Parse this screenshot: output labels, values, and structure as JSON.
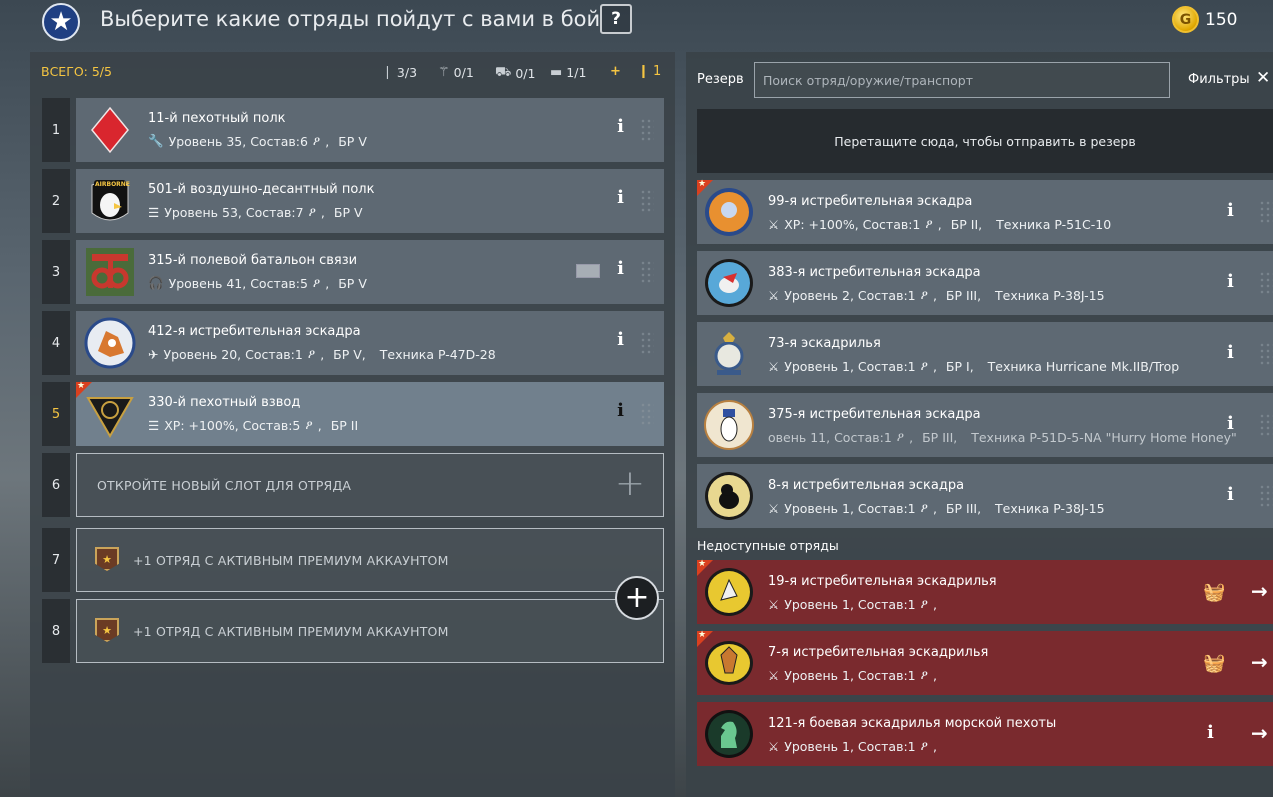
{
  "header": {
    "title": "Выберите какие отряды пойдут с вами в бой",
    "help_label": "?",
    "gold": "150",
    "gold_icon": "G"
  },
  "left": {
    "total": "ВСЕГО: 5/5",
    "counters": {
      "infantry": "3/3",
      "para": "0/1",
      "vehicle": "0/1",
      "tank": "1/1",
      "plus": "+",
      "ammo": "1"
    },
    "squads": [
      {
        "num": "1",
        "name": "11-й пехотный полк",
        "info": "Уровень 35, Состав:6",
        "br": "БР V"
      },
      {
        "num": "2",
        "name": "501-й воздушно-десантный полк",
        "info": "Уровень 53, Состав:7",
        "br": "БР V"
      },
      {
        "num": "3",
        "name": "315-й полевой батальон связи",
        "info": "Уровень 41, Состав:5",
        "br": "БР V"
      },
      {
        "num": "4",
        "name": "412-я истребительная эскадра",
        "info": "Уровень 20, Состав:1",
        "br": "БР V,",
        "vehicle": "Техника P-47D-28"
      },
      {
        "num": "5",
        "name": "330-й пехотный взвод",
        "info": "XP: +100%, Состав:5",
        "br": "БР II"
      }
    ],
    "empty_slots": [
      {
        "num": "6",
        "text": "ОТКРОЙТЕ НОВЫЙ СЛОТ ДЛЯ ОТРЯДА"
      },
      {
        "num": "7",
        "text": "+1 ОТРЯД С АКТИВНЫМ ПРЕМИУМ АККАУНТОМ"
      },
      {
        "num": "8",
        "text": "+1 ОТРЯД С АКТИВНЫМ ПРЕМИУМ АККАУНТОМ"
      }
    ],
    "airborne_text": "AIRBORNE"
  },
  "right": {
    "reserve_label": "Резерв",
    "search_placeholder": "Поиск отряд/оружие/транспорт",
    "filters_label": "Фильтры",
    "dropzone_text": "Перетащите сюда, чтобы отправить в резерв",
    "reserve": [
      {
        "name": "99-я истребительная эскадра",
        "info": "XP: +100%, Состав:1",
        "br": "БР II,",
        "vehicle": "Техника P-51C-10"
      },
      {
        "name": "383-я истребительная эскадра",
        "info": "Уровень 2, Состав:1",
        "br": "БР III,",
        "vehicle": "Техника P-38J-15"
      },
      {
        "name": "73-я эскадрилья",
        "info": "Уровень 1, Состав:1",
        "br": "БР I,",
        "vehicle": "Техника Hurricane Mk.IIB/Trop"
      },
      {
        "name": "375-я истребительная эскадра",
        "info": "овень 11, Состав:1",
        "br": "БР III,",
        "vehicle": "Техника P-51D-5-NA \"Hurry Home Honey\""
      },
      {
        "name": "8-я истребительная эскадра",
        "info": "Уровень 1, Состав:1",
        "br": "БР III,",
        "vehicle": "Техника P-38J-15"
      }
    ],
    "unavailable_label": "Недоступные отряды",
    "unavailable": [
      {
        "name": "19-я истребительная эскадрилья",
        "info": "Уровень 1, Состав:1"
      },
      {
        "name": "7-я истребительная эскадрилья",
        "info": "Уровень 1, Состав:1"
      },
      {
        "name": "121-я боевая эскадрилья морской пехоты",
        "info": "Уровень 1, Состав:1"
      }
    ]
  },
  "icons": {
    "star": "★",
    "info": "i",
    "person": "ዖ",
    "basket": "🧺",
    "arrow": "→",
    "plus": "+",
    "close": "✕"
  },
  "colors": {
    "accent": "#f5c542",
    "locked": "#7a2a2e",
    "card": "#5e6973",
    "selected": "#71808d",
    "premium_star": "#d9401f"
  }
}
